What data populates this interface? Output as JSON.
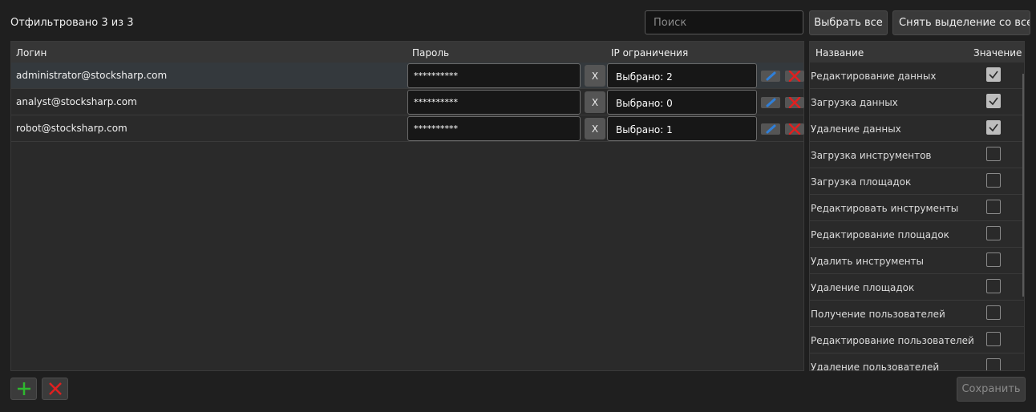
{
  "header": {
    "filter_status": "Отфильтровано 3 из 3",
    "search_placeholder": "Поиск",
    "select_all_label": "Выбрать все",
    "deselect_all_label": "Снять выделение со всех"
  },
  "users": {
    "columns": [
      "Логин",
      "Пароль",
      "IP ограничения"
    ],
    "rows": [
      {
        "login": "administrator@stocksharp.com",
        "password": "**********",
        "clear": "X",
        "ip": "Выбрано: 2",
        "selected": true
      },
      {
        "login": "analyst@stocksharp.com",
        "password": "**********",
        "clear": "X",
        "ip": "Выбрано: 0",
        "selected": false
      },
      {
        "login": "robot@stocksharp.com",
        "password": "**********",
        "clear": "X",
        "ip": "Выбрано: 1",
        "selected": false
      }
    ]
  },
  "permissions": {
    "columns": [
      "Название",
      "Значение"
    ],
    "items": [
      {
        "name": "Редактирование данных",
        "checked": true
      },
      {
        "name": "Загрузка данных",
        "checked": true
      },
      {
        "name": "Удаление данных",
        "checked": true
      },
      {
        "name": "Загрузка инструментов",
        "checked": false
      },
      {
        "name": "Загрузка площадок",
        "checked": false
      },
      {
        "name": "Редактировать инструменты",
        "checked": false
      },
      {
        "name": "Редактирование площадок",
        "checked": false
      },
      {
        "name": "Удалить инструменты",
        "checked": false
      },
      {
        "name": "Удаление площадок",
        "checked": false
      },
      {
        "name": "Получение пользователей",
        "checked": false
      },
      {
        "name": "Редактирование пользователей",
        "checked": false
      },
      {
        "name": "Удаление пользователей",
        "checked": false
      }
    ]
  },
  "footer": {
    "save_label": "Сохранить",
    "add_icon": "plus-icon",
    "remove_icon": "x-icon"
  },
  "colors": {
    "add_green": "#2eb82e",
    "delete_red": "#e02020",
    "edit_blue": "#2f7fd8"
  }
}
